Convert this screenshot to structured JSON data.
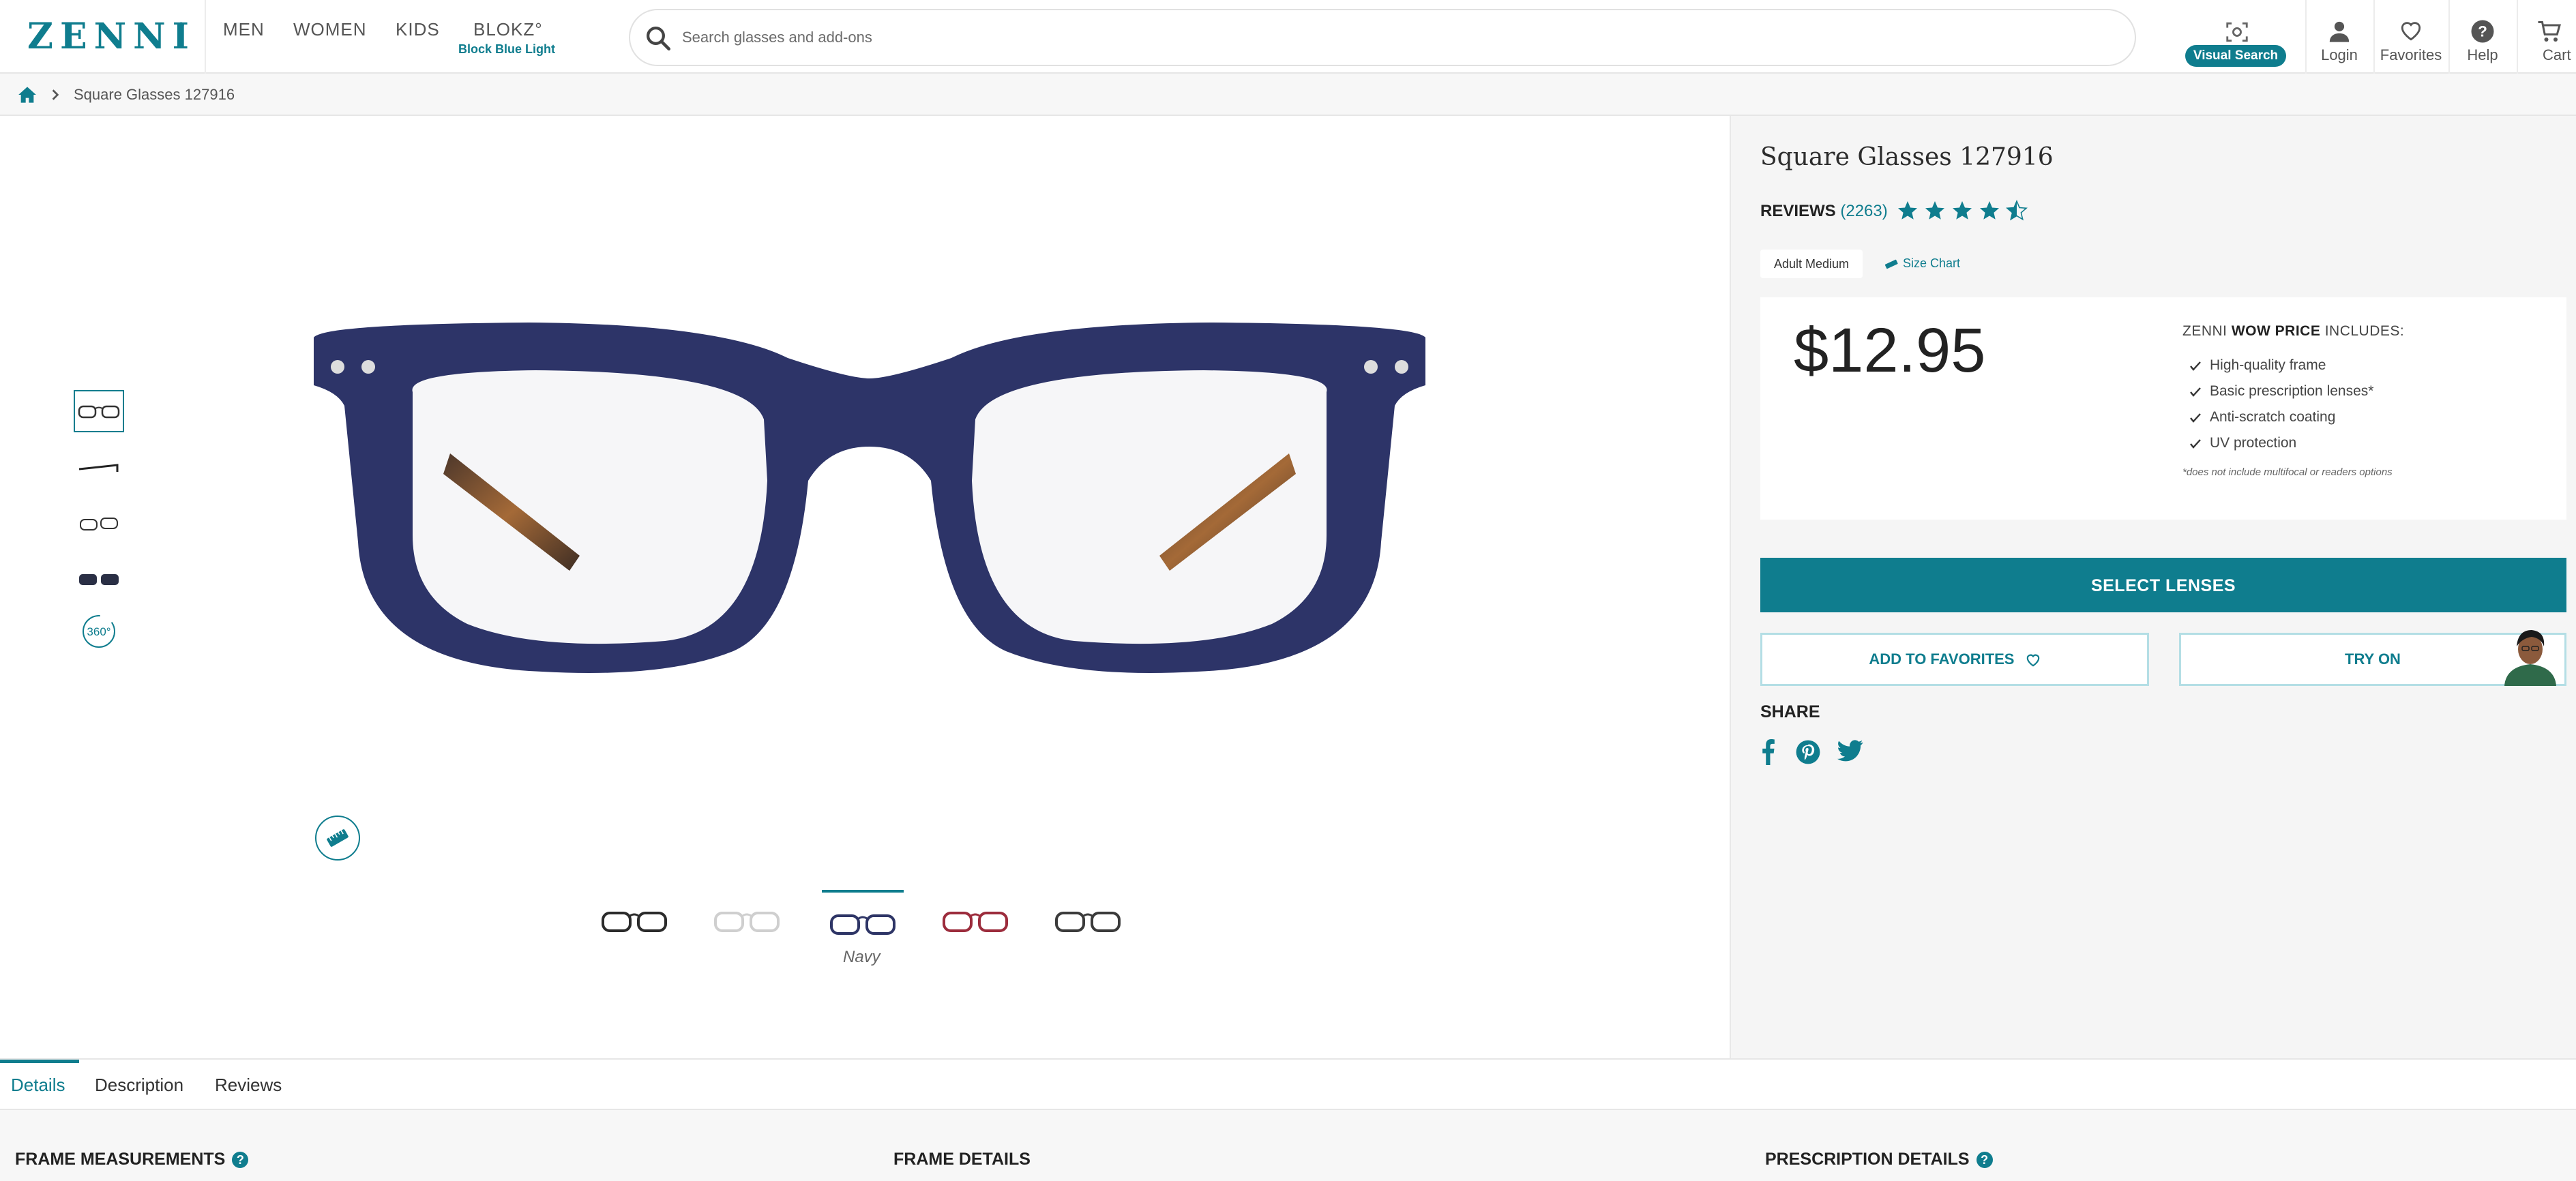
{
  "brand": {
    "logo": "ZENNI",
    "logo_mark": "®"
  },
  "nav": {
    "items": [
      {
        "label": "MEN"
      },
      {
        "label": "WOMEN"
      },
      {
        "label": "KIDS"
      },
      {
        "label": "BLOKZ°",
        "sub": "Block Blue Light"
      }
    ]
  },
  "search": {
    "placeholder": "Search glasses and add-ons"
  },
  "utility": {
    "visual_search": "Visual Search",
    "login": "Login",
    "favorites": "Favorites",
    "help": "Help",
    "cart": "Cart"
  },
  "breadcrumb": {
    "current": "Square Glasses 127916"
  },
  "product": {
    "title": "Square Glasses 127916",
    "reviews_label": "REVIEWS",
    "reviews_count": "(2263)",
    "rating": 4.5,
    "size": "Adult Medium",
    "size_chart": "Size Chart",
    "price": "$12.95",
    "wow_prefix": "ZENNI",
    "wow_bold": "WOW PRICE",
    "wow_suffix": "INCLUDES:",
    "includes": [
      "High-quality frame",
      "Basic prescription lenses*",
      "Anti-scratch coating",
      "UV protection"
    ],
    "footnote": "*does not include multifocal or readers options",
    "select_lenses": "SELECT LENSES",
    "add_favorites": "ADD TO FAVORITES",
    "try_on": "TRY ON",
    "share": "SHARE",
    "selected_color": "Navy"
  },
  "gallery": {
    "view_360": "360°"
  },
  "tabs": [
    "Details",
    "Description",
    "Reviews"
  ],
  "sections": {
    "frame_measurements": "FRAME MEASUREMENTS",
    "frame_details": "FRAME DETAILS",
    "prescription_details": "PRESCRIPTION DETAILS"
  },
  "colors": {
    "accent": "#0f7d8e",
    "swatches": [
      "#2b2b2b",
      "#d8d8d8",
      "#2e3566",
      "#9c2c3c",
      "#3b3b3b"
    ]
  }
}
